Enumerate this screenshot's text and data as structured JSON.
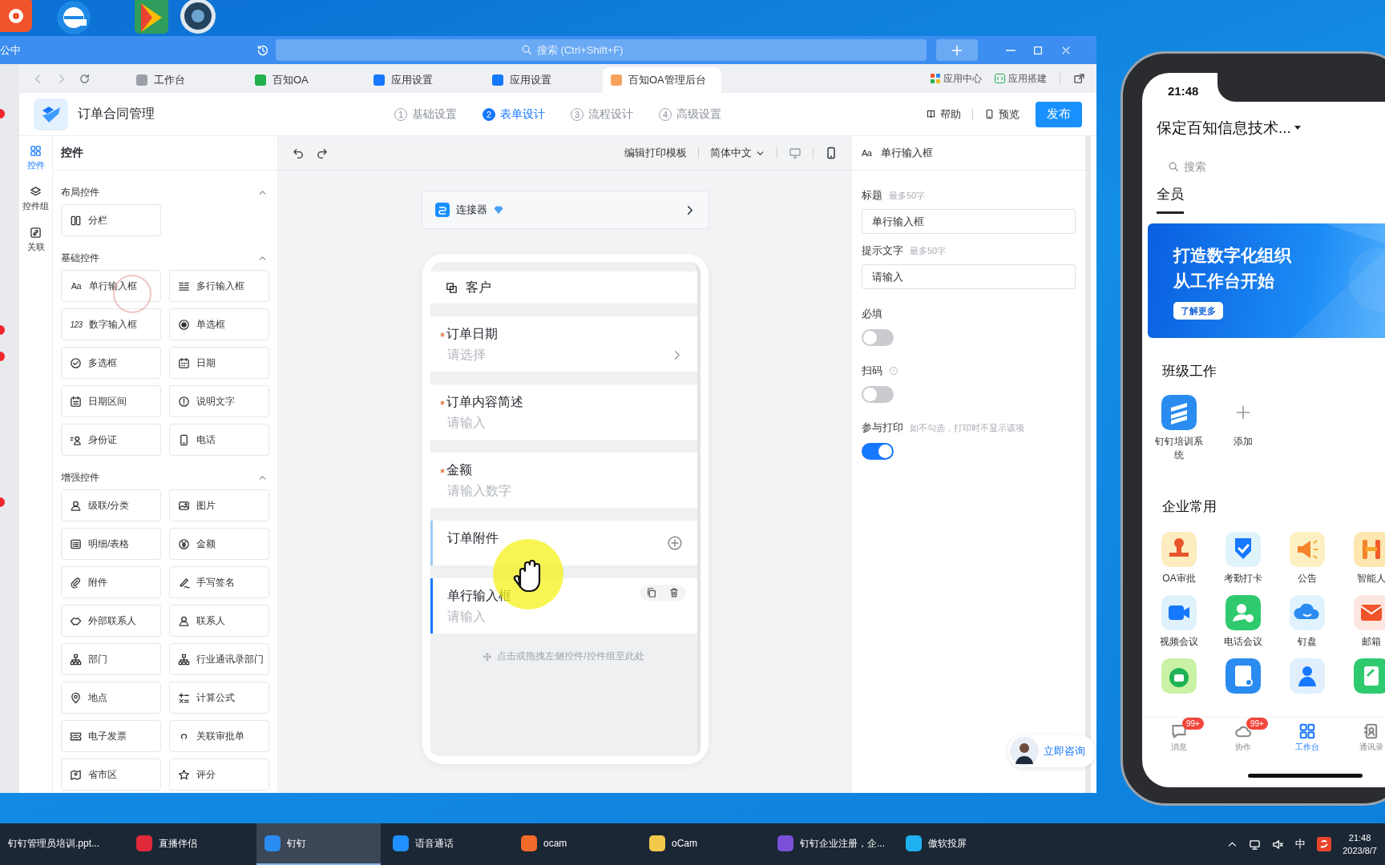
{
  "window": {
    "title": "公中",
    "search": {
      "placeholder": "搜索 (Ctrl+Shift+F)"
    }
  },
  "tabs": [
    {
      "label": "工作台",
      "selected": false,
      "color": "#9aa0a8"
    },
    {
      "label": "百知OA",
      "selected": false,
      "color": "#22b14c"
    },
    {
      "label": "应用设置",
      "selected": false,
      "color": "#1677ff"
    },
    {
      "label": "应用设置",
      "selected": false,
      "color": "#1677ff"
    },
    {
      "label": "百知OA管理后台",
      "selected": true,
      "color": "#f5a35c"
    }
  ],
  "tab_links": [
    {
      "label": "应用中心"
    },
    {
      "label": "应用搭建"
    }
  ],
  "app_header": {
    "title": "订单合同管理",
    "steps": [
      {
        "number": "1",
        "label": "基础设置",
        "selected": false
      },
      {
        "number": "2",
        "label": "表单设计",
        "selected": true
      },
      {
        "number": "3",
        "label": "流程设计",
        "selected": false
      },
      {
        "number": "4",
        "label": "高级设置",
        "selected": false
      }
    ],
    "help": "帮助",
    "preview": "预览",
    "publish": "发布"
  },
  "rail": [
    {
      "label": "控件",
      "selected": true
    },
    {
      "label": "控件组",
      "selected": false
    },
    {
      "label": "关联",
      "selected": false
    }
  ],
  "controls": {
    "title": "控件",
    "groups": [
      {
        "title": "布局控件",
        "expanded": true,
        "items": [
          {
            "label": "分栏"
          }
        ]
      },
      {
        "title": "基础控件",
        "expanded": true,
        "items": [
          {
            "label": "单行输入框",
            "glyph": "Aa"
          },
          {
            "label": "多行输入框"
          },
          {
            "label": "数字输入框",
            "glyph": "123"
          },
          {
            "label": "单选框"
          },
          {
            "label": "多选框"
          },
          {
            "label": "日期"
          },
          {
            "label": "日期区间"
          },
          {
            "label": "说明文字"
          },
          {
            "label": "身份证"
          },
          {
            "label": "电话"
          }
        ]
      },
      {
        "title": "增强控件",
        "expanded": true,
        "items": [
          {
            "label": "级联/分类"
          },
          {
            "label": "图片"
          },
          {
            "label": "明细/表格"
          },
          {
            "label": "金额"
          },
          {
            "label": "附件"
          },
          {
            "label": "手写签名"
          },
          {
            "label": "外部联系人"
          },
          {
            "label": "联系人"
          },
          {
            "label": "部门"
          },
          {
            "label": "行业通讯录部门"
          },
          {
            "label": "地点"
          },
          {
            "label": "计算公式"
          },
          {
            "label": "电子发票"
          },
          {
            "label": "关联审批单"
          },
          {
            "label": "省市区"
          },
          {
            "label": "评分"
          }
        ]
      }
    ]
  },
  "canvas": {
    "toolbar": {
      "print_template": "编辑打印模板",
      "language": "简体中文",
      "views": [
        {
          "kind": "desktop",
          "selected": false
        },
        {
          "kind": "mobile",
          "selected": true
        }
      ]
    },
    "connector": "连接器",
    "fields": [
      {
        "kind": "section",
        "label": "客户",
        "selected": false,
        "hovered": false
      },
      {
        "kind": "select",
        "label": "订单日期",
        "placeholder": "请选择",
        "required": true,
        "selected": false,
        "hovered": false
      },
      {
        "kind": "input",
        "label": "订单内容简述",
        "placeholder": "请输入",
        "required": true,
        "selected": false,
        "hovered": false
      },
      {
        "kind": "input",
        "label": "金额",
        "placeholder": "请输入数字",
        "required": true,
        "selected": false,
        "hovered": false
      },
      {
        "kind": "attachment",
        "label": "订单附件",
        "required": false,
        "selected": false,
        "hovered": true
      },
      {
        "kind": "input",
        "label": "单行输入框",
        "placeholder": "请输入",
        "required": false,
        "selected": true,
        "hovered": false
      }
    ],
    "drop_hint": "点击或拖拽左侧控件/控件组至此处"
  },
  "properties": {
    "glyph": "Aa",
    "title": "单行输入框",
    "fields": [
      {
        "label": "标题",
        "hint": "最多50字",
        "value": "单行输入框"
      },
      {
        "label": "提示文字",
        "hint": "最多50字",
        "value": "请输入"
      }
    ],
    "switches": [
      {
        "label": "必填",
        "on": false,
        "info": false
      },
      {
        "label": "扫码",
        "on": false,
        "info": true
      },
      {
        "label": "参与打印",
        "on": true,
        "info": false,
        "hint": "如不勾选，打印时不显示该项"
      }
    ]
  },
  "consult": "立即咨询",
  "phone": {
    "time": "21:48",
    "org": "保定百知信息技术...",
    "search_placeholder": "搜索",
    "tabs": [
      {
        "label": "全员",
        "selected": true
      }
    ],
    "banner": {
      "line1": "打造数字化组织",
      "line2": "从工作台开始",
      "button": "了解更多"
    },
    "class_work": {
      "title": "班级工作",
      "apps": [
        {
          "kind": "app",
          "label": "钉钉培训系统"
        },
        {
          "kind": "add",
          "label": "添加"
        }
      ]
    },
    "common": {
      "title": "企业常用",
      "apps": [
        {
          "label": "OA审批",
          "color": "#fdecc0"
        },
        {
          "label": "考勤打卡",
          "color": "#dff3fb"
        },
        {
          "label": "公告",
          "color": "#fdf1c4"
        },
        {
          "label": "智能人",
          "color": "#fde6b0"
        },
        {
          "label": "视频会议",
          "color": "#dff1fb"
        },
        {
          "label": "电话会议",
          "color": "#2fca6e"
        },
        {
          "label": "钉盘",
          "color": "#e0f2fd"
        },
        {
          "label": "邮箱",
          "color": "#fde6e0"
        },
        {
          "color": "#c9f2a6"
        },
        {
          "color": "#2a8cf0"
        },
        {
          "color": "#e0effb"
        },
        {
          "color": "#2fca6e"
        }
      ]
    },
    "nav": [
      {
        "label": "消息",
        "badge": "99+",
        "selected": false
      },
      {
        "label": "协作",
        "badge": "99+",
        "selected": false
      },
      {
        "label": "工作台",
        "selected": true
      },
      {
        "label": "通讯录",
        "selected": false
      }
    ]
  },
  "taskbar": {
    "items": [
      {
        "label": "钉钉管理员培训.ppt...",
        "selected": false
      },
      {
        "label": "直播伴侣",
        "selected": false,
        "color": "#e02a3a"
      },
      {
        "label": "钉钉",
        "selected": true,
        "color": "#2a8cf0"
      },
      {
        "label": "语音通话",
        "selected": false,
        "color": "#1e90ff"
      },
      {
        "label": "ocam",
        "selected": false,
        "color": "#f06a2a"
      },
      {
        "label": "oCam",
        "selected": false,
        "color": "#f2c94c"
      },
      {
        "label": "钉钉企业注册，企...",
        "selected": false,
        "color": "#7b4fd8"
      },
      {
        "label": "傲软投屏",
        "selected": false,
        "color": "#1fb0f0"
      }
    ],
    "ime": "中",
    "time": "21:48",
    "date": "2023/8/7"
  }
}
